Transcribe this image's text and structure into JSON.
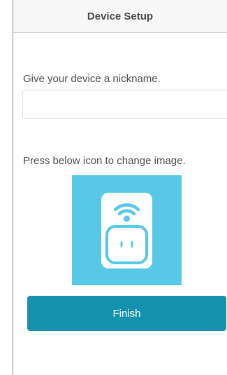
{
  "header": {
    "title": "Device Setup"
  },
  "nickname": {
    "prompt": "Give your device a nickname.",
    "value": "",
    "placeholder": ""
  },
  "image": {
    "prompt": "Press below icon to change image.",
    "icon": "wifi-smart-plug-icon"
  },
  "actions": {
    "finish_label": "Finish"
  },
  "colors": {
    "accent": "#1591ae",
    "icon_background": "#57c8e7"
  }
}
